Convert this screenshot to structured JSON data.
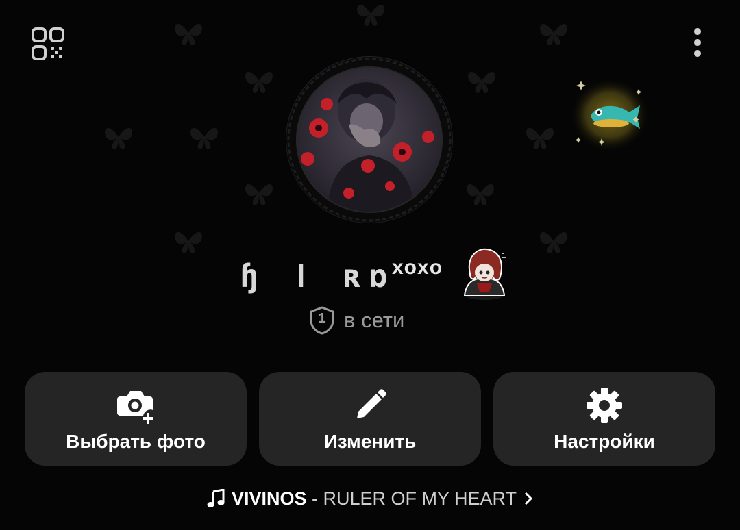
{
  "profile": {
    "name": "ɧ ǀ ʀɒ",
    "name_suffix": "xoxo",
    "status_count": "1",
    "status_text": "в сети"
  },
  "actions": [
    {
      "label": "Выбрать фото",
      "icon": "camera-add-icon"
    },
    {
      "label": "Изменить",
      "icon": "pencil-icon"
    },
    {
      "label": "Настройки",
      "icon": "gear-icon"
    }
  ],
  "music": {
    "artist": "VIVINOS",
    "separator": " - ",
    "title": "RULER OF MY HEART"
  },
  "icons": {
    "top_left": "qr-code-icon",
    "top_right": "more-vertical-icon",
    "music": "music-note-icon",
    "music_arrow": "chevron-right-icon",
    "collectible": "fish-gift-icon"
  },
  "colors": {
    "background": "#050505",
    "button_bg": "#252525",
    "accent_red": "#c4202a",
    "status_gray": "#9a9a9a"
  }
}
